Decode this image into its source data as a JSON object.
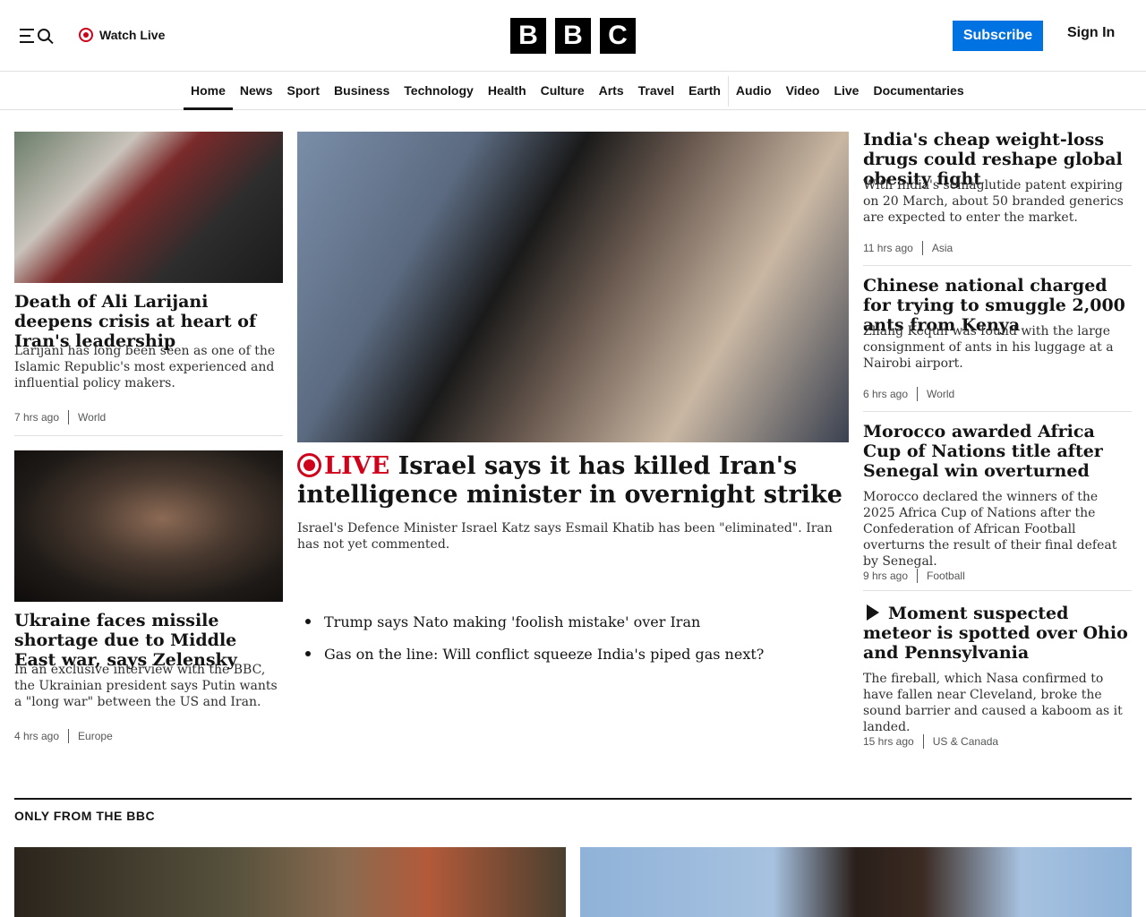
{
  "header": {
    "watch_live": "Watch Live",
    "logo_letters": [
      "B",
      "B",
      "C"
    ],
    "subscribe": "Subscribe",
    "sign_in": "Sign In"
  },
  "nav": {
    "items": [
      "Home",
      "News",
      "Sport",
      "Business",
      "Technology",
      "Health",
      "Culture",
      "Arts",
      "Travel",
      "Earth",
      "Audio",
      "Video",
      "Live",
      "Documentaries"
    ],
    "active": "Home"
  },
  "left_column": [
    {
      "headline": "Death of Ali Larijani deepens crisis at heart of Iran's leadership",
      "summary": "Larijani has long been seen as one of the Islamic Republic's most experienced and influential policy makers.",
      "time": "7 hrs ago",
      "category": "World"
    },
    {
      "headline": "Ukraine faces missile shortage due to Middle East war, says Zelensky",
      "summary": "In an exclusive interview with the BBC, the Ukrainian president says Putin wants a \"long war\" between the US and Iran.",
      "time": "4 hrs ago",
      "category": "Europe"
    }
  ],
  "main_story": {
    "live_label": "LIVE",
    "headline": "Israel says it has killed Iran's intelligence minister in overnight strike",
    "summary": "Israel's Defence Minister Israel Katz says Esmail Khatib has been \"eliminated\". Iran has not yet commented.",
    "related": [
      "Trump says Nato making 'foolish mistake' over Iran",
      "Gas on the line: Will conflict squeeze India's piped gas next?"
    ]
  },
  "right_column": [
    {
      "headline": "India's cheap weight-loss drugs could reshape global obesity fight",
      "summary": "With India's semaglutide patent expiring on 20 March, about 50 branded generics are expected to enter the market.",
      "time": "11 hrs ago",
      "category": "Asia"
    },
    {
      "headline": "Chinese national charged for trying to smuggle 2,000 ants from Kenya",
      "summary": "Zhang Kequn was found with the large consignment of ants in his luggage at a Nairobi airport.",
      "time": "6 hrs ago",
      "category": "World"
    },
    {
      "headline": "Morocco awarded Africa Cup of Nations title after Senegal win overturned",
      "summary": "Morocco declared the winners of the 2025 Africa Cup of Nations after the Confederation of African Football overturns the result of their final defeat by Senegal.",
      "time": "9 hrs ago",
      "category": "Football"
    },
    {
      "headline": "Moment suspected meteor is spotted over Ohio and Pennsylvania",
      "summary": "The fireball, which Nasa confirmed to have fallen near Cleveland, broke the sound barrier and caused a kaboom as it landed.",
      "time": "15 hrs ago",
      "category": "US & Canada"
    }
  ],
  "section": {
    "title": "ONLY FROM THE BBC"
  },
  "colors": {
    "accent_blue": "#0072e1",
    "live_red": "#d0021b",
    "text": "#141414"
  }
}
